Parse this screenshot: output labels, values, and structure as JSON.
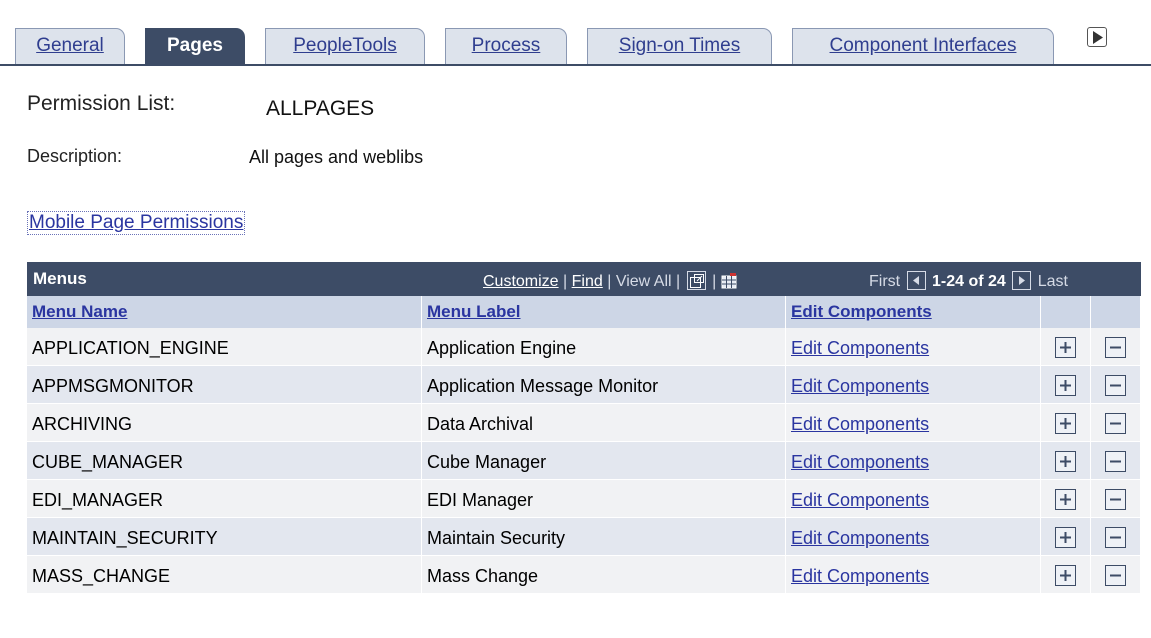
{
  "tabs": [
    {
      "label": "General",
      "active": false
    },
    {
      "label": "Pages",
      "active": true
    },
    {
      "label": "PeopleTools",
      "active": false
    },
    {
      "label": "Process",
      "active": false
    },
    {
      "label": "Sign-on Times",
      "active": false
    },
    {
      "label": "Component Interfaces",
      "active": false
    }
  ],
  "header": {
    "permission_label": "Permission List:",
    "permission_value": "ALLPAGES",
    "description_label": "Description:",
    "description_value": "All pages and weblibs",
    "mobile_link": "Mobile Page Permissions"
  },
  "grid": {
    "title": "Menus",
    "customize": "Customize",
    "find": "Find",
    "view_all": "View All",
    "first": "First",
    "range": "1-24 of 24",
    "last": "Last",
    "columns": [
      "Menu Name",
      "Menu Label",
      "Edit Components"
    ],
    "rows": [
      {
        "name": "APPLICATION_ENGINE",
        "label": "Application Engine",
        "edit": "Edit Components"
      },
      {
        "name": "APPMSGMONITOR",
        "label": "Application Message Monitor",
        "edit": "Edit Components"
      },
      {
        "name": "ARCHIVING",
        "label": "Data Archival",
        "edit": "Edit Components"
      },
      {
        "name": "CUBE_MANAGER",
        "label": "Cube Manager",
        "edit": "Edit Components"
      },
      {
        "name": "EDI_MANAGER",
        "label": "EDI Manager",
        "edit": "Edit Components"
      },
      {
        "name": "MAINTAIN_SECURITY",
        "label": "Maintain Security",
        "edit": "Edit Components"
      },
      {
        "name": "MASS_CHANGE",
        "label": "Mass Change",
        "edit": "Edit Components"
      }
    ]
  },
  "icons": {
    "tab_more": "triangle-right-icon",
    "zoom": "new-window-icon",
    "download": "spreadsheet-icon",
    "prev": "triangle-left-icon",
    "next": "triangle-right-icon",
    "add": "plus-icon",
    "remove": "minus-icon"
  },
  "colors": {
    "tab_active": "#3d4c66",
    "tab_inactive": "#dde3ec",
    "link": "#2a35a0",
    "grid_header": "#3d4c66",
    "column_header": "#cdd6e6",
    "row_odd": "#f1f2f4",
    "row_even": "#e3e7ef"
  }
}
